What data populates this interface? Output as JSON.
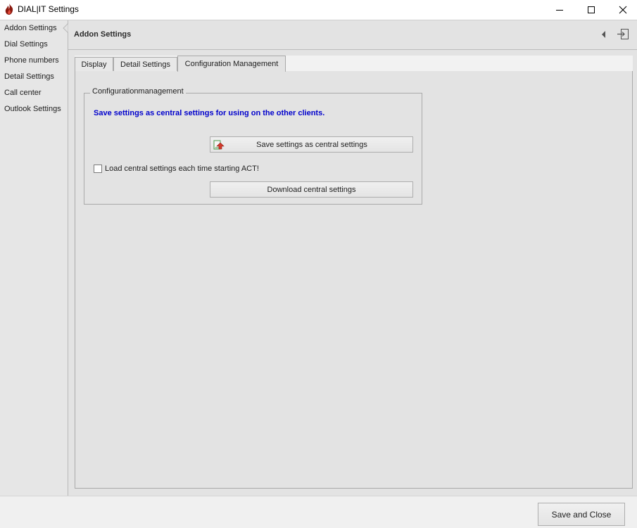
{
  "window": {
    "title": "DIAL|IT Settings",
    "controls": [
      "minimize",
      "maximize",
      "close"
    ]
  },
  "sidebar": {
    "items": [
      {
        "label": "Addon Settings",
        "selected": true
      },
      {
        "label": "Dial Settings"
      },
      {
        "label": "Phone numbers"
      },
      {
        "label": "Detail Settings"
      },
      {
        "label": "Call center"
      },
      {
        "label": "Outlook Settings"
      }
    ]
  },
  "main": {
    "title": "Addon Settings",
    "header_icons": [
      "collapse-arrow-icon",
      "exit-panel-icon"
    ],
    "tabs": [
      {
        "label": "Display"
      },
      {
        "label": "Detail Settings"
      },
      {
        "label": "Configuration Management",
        "active": true
      }
    ],
    "group": {
      "legend": "Configurationmanagement",
      "hint": "Save settings as central settings for using on the other clients.",
      "save_button": "Save settings as central settings",
      "checkbox_label": "Load central settings each time starting ACT!",
      "checkbox_checked": false,
      "download_button": "Download central settings"
    }
  },
  "footer": {
    "save_close": "Save and Close"
  },
  "colors": {
    "hint_text": "#0000cc",
    "app_icon": "#c0392b"
  }
}
